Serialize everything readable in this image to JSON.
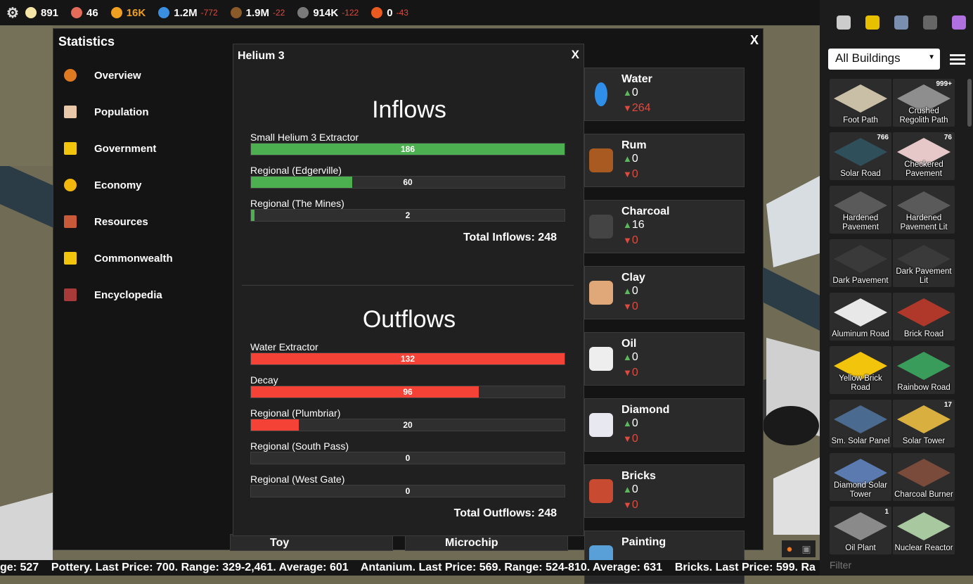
{
  "topbar": {
    "stats": [
      {
        "icon": "lightbulb-icon",
        "color": "#f5e6a8",
        "value": "891",
        "delta": "",
        "value_color": "#ffffff"
      },
      {
        "icon": "people-icon",
        "color": "#e36b5a",
        "value": "46",
        "delta": "",
        "value_color": "#ffffff"
      },
      {
        "icon": "lightning-icon",
        "color": "#f0a020",
        "value": "16K",
        "delta": "",
        "value_color": "#f0a020"
      },
      {
        "icon": "water-drop-icon",
        "color": "#3a8fe0",
        "value": "1.2M",
        "delta": "-772",
        "value_color": "#ffffff"
      },
      {
        "icon": "food-icon",
        "color": "#8a5a2a",
        "value": "1.9M",
        "delta": "-22",
        "value_color": "#ffffff"
      },
      {
        "icon": "rock-icon",
        "color": "#7a7a7a",
        "value": "914K",
        "delta": "-122",
        "value_color": "#ffffff"
      },
      {
        "icon": "fire-icon",
        "color": "#e85a20",
        "value": "0",
        "delta": "-43",
        "value_color": "#ffffff"
      }
    ]
  },
  "statistics": {
    "title": "Statistics",
    "close": "X",
    "nav": [
      {
        "label": "Overview",
        "icon": "home-icon"
      },
      {
        "label": "Population",
        "icon": "people-icon"
      },
      {
        "label": "Government",
        "icon": "crown-icon"
      },
      {
        "label": "Economy",
        "icon": "coin-icon"
      },
      {
        "label": "Resources",
        "icon": "resources-icon"
      },
      {
        "label": "Commonwealth",
        "icon": "crown-icon"
      },
      {
        "label": "Encyclopedia",
        "icon": "book-icon"
      }
    ],
    "resources": [
      {
        "name": "Water",
        "up": "0",
        "down": "264",
        "icon": "water-drop-icon"
      },
      {
        "name": "Rum",
        "up": "0",
        "down": "0",
        "icon": "rum-bottle-icon"
      },
      {
        "name": "Charcoal",
        "up": "16",
        "down": "0",
        "icon": "charcoal-icon"
      },
      {
        "name": "Clay",
        "up": "0",
        "down": "0",
        "icon": "clay-icon"
      },
      {
        "name": "Oil",
        "up": "0",
        "down": "0",
        "icon": "oil-barrel-icon"
      },
      {
        "name": "Diamond",
        "up": "0",
        "down": "0",
        "icon": "diamond-icon"
      },
      {
        "name": "Bricks",
        "up": "0",
        "down": "0",
        "icon": "bricks-icon"
      },
      {
        "name": "Painting",
        "icon": "painting-icon"
      }
    ],
    "under_cards": {
      "toy": "Toy",
      "microchip": "Microchip"
    }
  },
  "helium": {
    "title": "Helium 3",
    "close": "X",
    "inflows_title": "Inflows",
    "outflows_title": "Outflows",
    "inflows": [
      {
        "label": "Small Helium 3 Extractor",
        "value": "186",
        "fraction": 1.0
      },
      {
        "label": "Regional (Edgerville)",
        "value": "60",
        "fraction": 0.323
      },
      {
        "label": "Regional (The Mines)",
        "value": "2",
        "fraction": 0.011
      }
    ],
    "outflows": [
      {
        "label": "Water Extractor",
        "value": "132",
        "fraction": 1.0
      },
      {
        "label": "Decay",
        "value": "96",
        "fraction": 0.727
      },
      {
        "label": "Regional (Plumbriar)",
        "value": "20",
        "fraction": 0.152
      },
      {
        "label": "Regional (South Pass)",
        "value": "0",
        "fraction": 0
      },
      {
        "label": "Regional (West Gate)",
        "value": "0",
        "fraction": 0
      }
    ],
    "total_inflows": "Total Inflows: 248",
    "total_outflows": "Total Outflows: 248",
    "inflow_color": "#4caf50",
    "outflow_color": "#f44336"
  },
  "build_panel": {
    "category_icons": [
      "rocket-icon",
      "bulldozer-icon",
      "solar-panel-icon",
      "pavement-icon",
      "flask-icon"
    ],
    "dropdown_value": "All Buildings",
    "list_view_icon": "list-icon",
    "buildings": [
      {
        "name": "Foot Path",
        "count": "",
        "color": "#c9bfa6"
      },
      {
        "name": "Crushed Regolith Path",
        "count": "999+",
        "color": "#8e8e8e"
      },
      {
        "name": "Solar Road",
        "count": "766",
        "color": "#2f4f5a"
      },
      {
        "name": "Checkered Pavement",
        "count": "76",
        "color": "#e6c8c8"
      },
      {
        "name": "Hardened Pavement",
        "count": "",
        "color": "#5a5a5a"
      },
      {
        "name": "Hardened Pavement Lit",
        "count": "",
        "color": "#5a5a5a"
      },
      {
        "name": "Dark Pavement",
        "count": "",
        "color": "#3a3a3a"
      },
      {
        "name": "Dark Pavement Lit",
        "count": "",
        "color": "#3a3a3a"
      },
      {
        "name": "Aluminum Road",
        "count": "",
        "color": "#e8e8e8"
      },
      {
        "name": "Brick Road",
        "count": "",
        "color": "#b0382a"
      },
      {
        "name": "Yellow Brick Road",
        "count": "",
        "color": "#f2c40c"
      },
      {
        "name": "Rainbow Road",
        "count": "",
        "color": "#3a9c5a"
      },
      {
        "name": "Sm. Solar Panel",
        "count": "",
        "color": "#4a6a90"
      },
      {
        "name": "Solar Tower",
        "count": "17",
        "color": "#d9b040"
      },
      {
        "name": "Diamond Solar Tower",
        "count": "",
        "color": "#5a7ab0"
      },
      {
        "name": "Charcoal Burner",
        "count": "",
        "color": "#7a4a3a"
      },
      {
        "name": "Oil Plant",
        "count": "1",
        "color": "#8a8a8a"
      },
      {
        "name": "Nuclear Reactor",
        "count": "",
        "color": "#a8c8a0"
      }
    ],
    "filter_placeholder": "Filter"
  },
  "ticker": {
    "text": "ge: 527    Pottery. Last Price: 700. Range: 329-2,461. Average: 601    Antanium. Last Price: 569. Range: 524-810. Average: 631    Bricks. Last Price: 599. Ra"
  }
}
